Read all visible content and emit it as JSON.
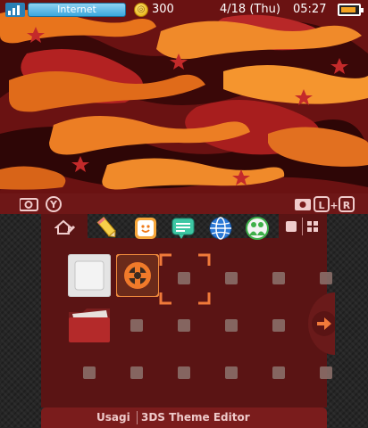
{
  "status": {
    "connection": "Internet",
    "coins": "300",
    "date": "4/18 (Thu)",
    "time": "05:27"
  },
  "top_footer": {
    "left_button": "Y",
    "right_buttons": [
      "L",
      "R"
    ]
  },
  "shortcuts": [
    {
      "name": "notes",
      "icon": "pencil-icon"
    },
    {
      "name": "miiverse",
      "icon": "smile-icon"
    },
    {
      "name": "notifications",
      "icon": "speech-bubble-icon"
    },
    {
      "name": "internet-browser",
      "icon": "globe-icon"
    },
    {
      "name": "friend-list",
      "icon": "friends-icon"
    }
  ],
  "apps": [
    {
      "name": "empty-cartridge",
      "icon": "cartridge-icon"
    },
    {
      "name": "tf2-app",
      "icon": "tf2-logo-icon"
    }
  ],
  "bottom_bar": {
    "user": "Usagi",
    "app": "3DS Theme Editor"
  },
  "colors": {
    "accent": "#7a1c1c",
    "grid_bg": "#5a1414",
    "slot": "#8a6e68",
    "cursor": "#f07a3a"
  }
}
